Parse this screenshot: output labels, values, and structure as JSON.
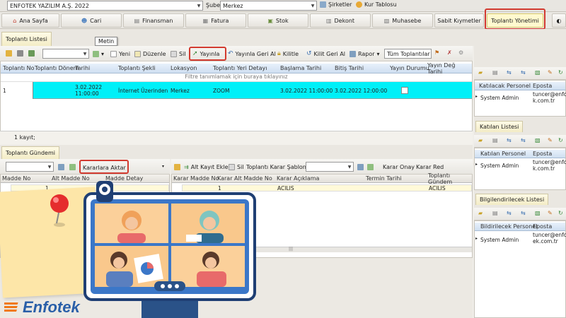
{
  "topbar": {
    "company": "ENFOTEK YAZILIM A.Ş. 2022",
    "sube_label": "Şube",
    "sube_value": "Merkez",
    "sirketler": "Şirketler",
    "kur_tablosu": "Kur Tablosu"
  },
  "modules": {
    "ana_sayfa": "Ana Sayfa",
    "cari": "Cari",
    "finansman": "Finansman",
    "fatura": "Fatura",
    "stok": "Stok",
    "dekont": "Dekont",
    "muhasebe": "Muhasebe",
    "sabit": "Sabit Kıymetler",
    "toplanti": "Toplantı Yönetimi"
  },
  "doc_tab": "Toplantı Listesi",
  "tooltip": "Metin",
  "toolbar": {
    "yeni": "Yeni",
    "duzenle": "Düzenle",
    "sil": "Sil",
    "yayinla": "Yayınla",
    "yayinla_geri_al": "Yayınla Geri Al",
    "kilitle": "Kilitle",
    "kilit_geri_al": "Kilit Geri Al",
    "rapor": "Rapor",
    "filter_value": "Tüm Toplantılar"
  },
  "grid": {
    "columns": [
      "Toplantı No",
      "Toplantı Dönem",
      "Tarihi",
      "Toplantı Şekli",
      "Lokasyon",
      "Toplantı Yeri Detayı",
      "Başlama Tarihi",
      "Bitiş Tarihi",
      "Yayın Durumu",
      "Yayın Değ Tarihi"
    ],
    "filter_hint": "Filtre tanımlamak için buraya tıklayınız",
    "row": {
      "no": "1",
      "tarih_1": "3.02.2022",
      "tarih_2": "11:00:00",
      "sekil": "İnternet Üzerinden",
      "lokasyon": "Merkez",
      "yer": "ZOOM",
      "baslama": "3.02.2022 11:00:00",
      "bitis": "3.02.2022 12:00:00"
    },
    "count": "1 kayıt;"
  },
  "gundem": {
    "tab": "Toplantı Gündemi",
    "aktar": "Kararlara Aktar",
    "left_cols": [
      "Madde No",
      "Alt Madde No",
      "Madde Detay"
    ],
    "left_row": "1",
    "alt_kayit_ekle": "Alt Kayıt Ekle",
    "sil": "Sil",
    "sablon": "Toplantı Karar Şablon",
    "onay": "Karar Onay",
    "red": "Karar Red",
    "right_cols": [
      "Karar Madde No",
      "Karar Alt Madde No",
      "Karar Açıklama",
      "Termin Tarihi",
      "Toplantı Gündem"
    ],
    "right_row": {
      "madde": "1",
      "aciklama": "ACILIS",
      "gundem": "ACILIS"
    }
  },
  "side": {
    "katilacak_col1": "Katılacak Personel",
    "eposta": "Eposta",
    "person": "System Admin",
    "email_a": "tuncer@enfote",
    "email_b": "k.com.tr",
    "email_c": "tuncer@enfot",
    "email_d": "ek.com.tr",
    "katilan_tab": "Katılan Listesi",
    "katilan_col1": "Katılan Personel",
    "bilgi_tab": "Bilgilendirilecek Listesi",
    "bilgi_col1": "Bildirilecek Personel"
  },
  "logo": "Enfotek",
  "colors": {
    "accent_red": "#d23a2f",
    "selected_row": "#00f0f8",
    "brand_blue": "#2a5fa8",
    "brand_orange": "#f07a1a"
  }
}
